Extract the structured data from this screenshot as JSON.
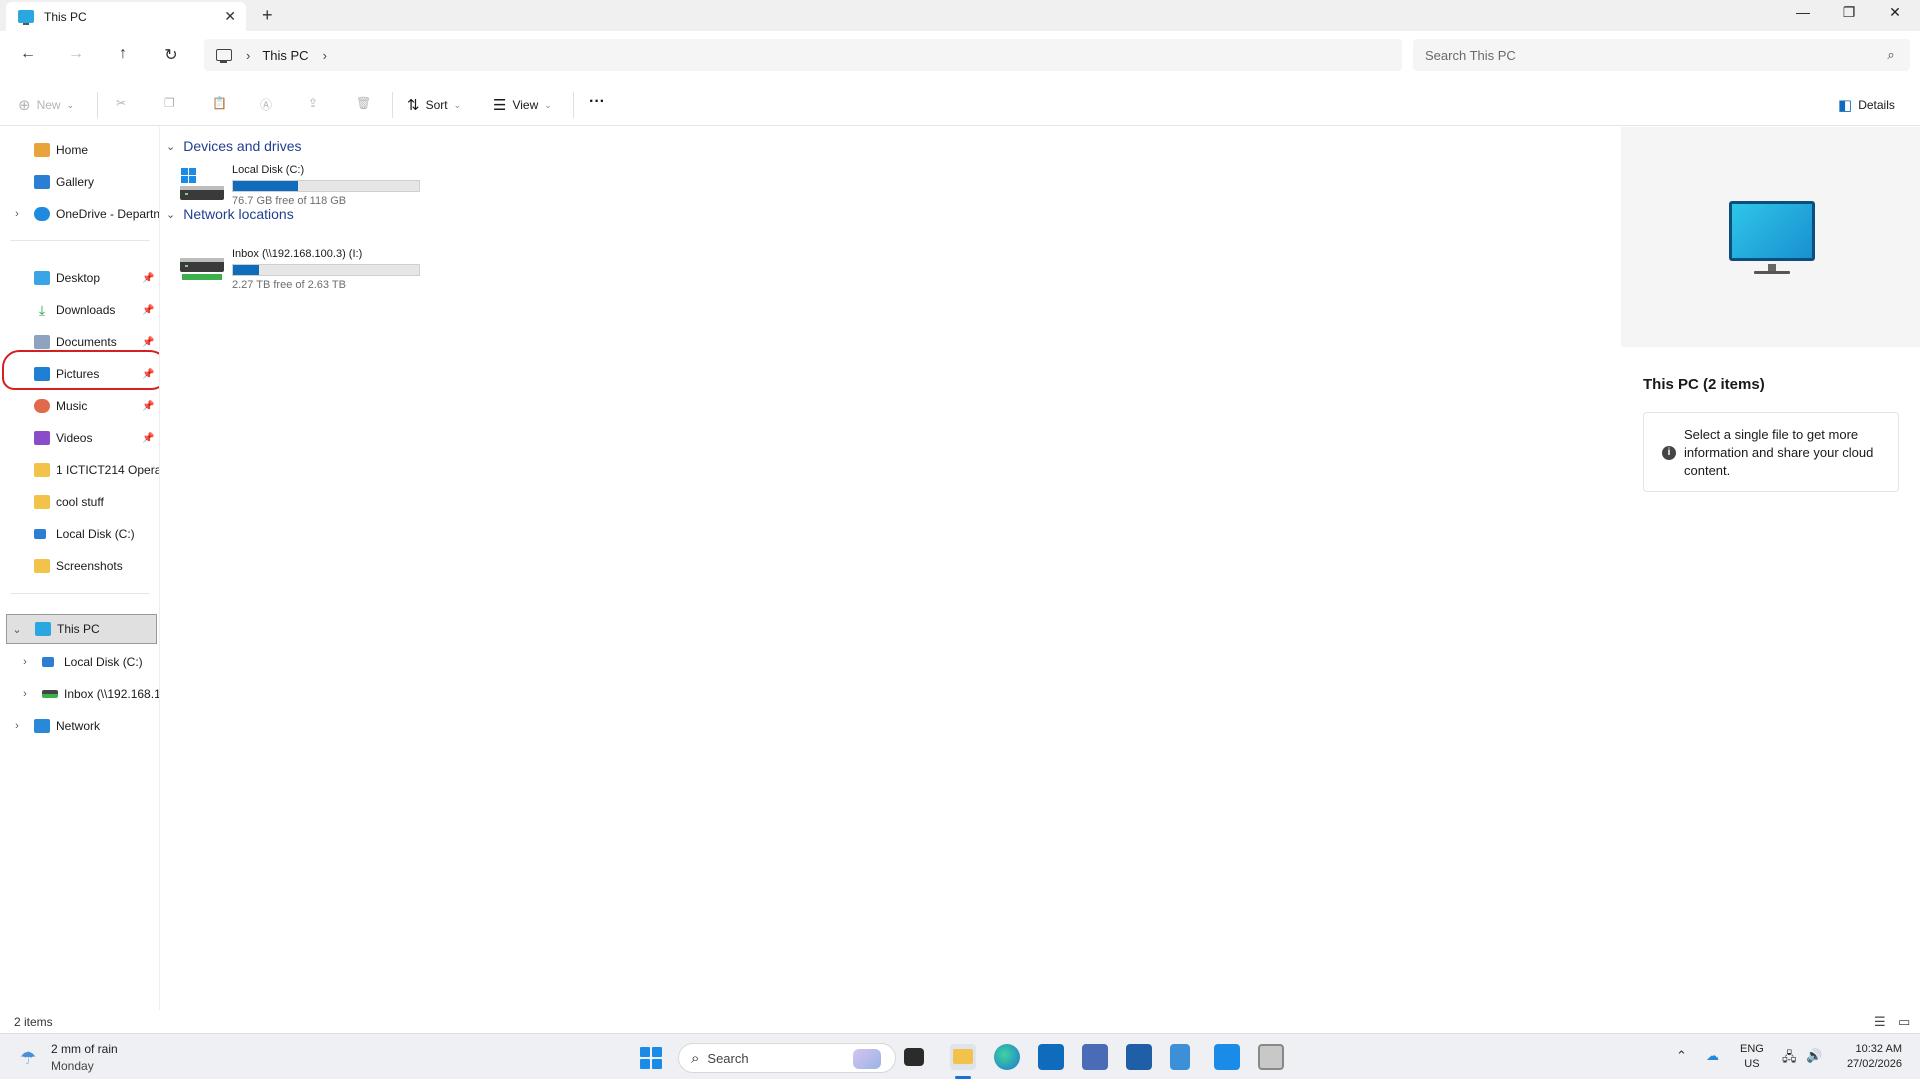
{
  "window": {
    "tab_title": "This PC",
    "tab_close": "✕",
    "new_tab": "+",
    "minimize": "—",
    "maximize": "❐",
    "close": "✕"
  },
  "address": {
    "breadcrumb": "This PC",
    "search_placeholder": "Search This PC"
  },
  "toolbar": {
    "new_label": "New",
    "sort_label": "Sort",
    "view_label": "View",
    "more_label": "···",
    "details_label": "Details"
  },
  "nav": {
    "home": "Home",
    "gallery": "Gallery",
    "onedrive": "OneDrive - Departn",
    "desktop": "Desktop",
    "downloads": "Downloads",
    "documents": "Documents",
    "pictures": "Pictures",
    "music": "Music",
    "videos": "Videos",
    "folder_ict": "1 ICTICT214 Operat",
    "folder_cool": "cool stuff",
    "local_disk_quick": "Local Disk (C:)",
    "screenshots": "Screenshots",
    "this_pc": "This PC",
    "local_disk": "Local Disk (C:)",
    "inbox": "Inbox (\\\\192.168.1",
    "network": "Network"
  },
  "content": {
    "devices_header": "Devices and drives",
    "network_header": "Network locations",
    "drives": [
      {
        "name": "Local Disk (C:)",
        "free": "76.7 GB free of 118 GB",
        "used_fraction": 0.35
      }
    ],
    "network": [
      {
        "name": "Inbox (\\\\192.168.100.3) (I:)",
        "free": "2.27 TB free of 2.63 TB",
        "used_fraction": 0.14
      }
    ]
  },
  "details": {
    "title": "This PC (2 items)",
    "message": "Select a single file to get more information and share your cloud content."
  },
  "status": {
    "item_count": "2 items"
  },
  "taskbar": {
    "weather_title": "2 mm of rain",
    "weather_sub": "Monday",
    "search_label": "Search",
    "lang_top": "ENG",
    "lang_bottom": "US",
    "time": "10:32 AM",
    "date": "27/02/2026"
  },
  "colors": {
    "accent": "#0f6cbd",
    "annotation": "#d42020",
    "group_header": "#1f3f8f"
  }
}
